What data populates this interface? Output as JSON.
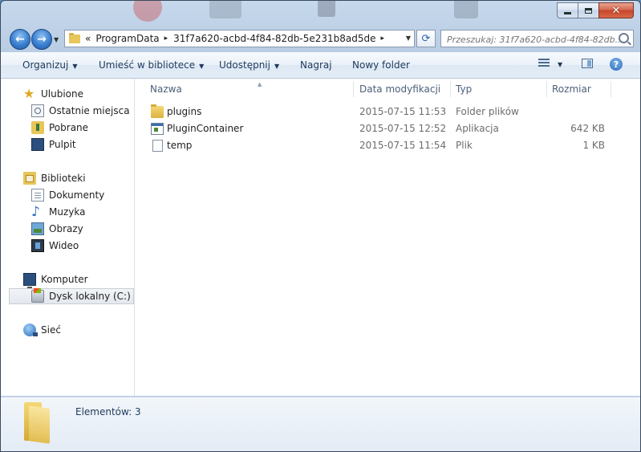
{
  "window": {
    "controls": {
      "minimize_glyph": "",
      "maximize_glyph": "",
      "close_glyph": "✕"
    },
    "colors": {
      "accent": "#3a7fd0",
      "frame": "#b9cde3",
      "close": "#c7462a"
    }
  },
  "address_bar": {
    "overflow": "«",
    "crumbs": [
      "ProgramData",
      "31f7a620-acbd-4f84-82db-5e231b8ad5de"
    ],
    "separator": "▸"
  },
  "search": {
    "placeholder": "Przeszukaj: 31f7a620-acbd-4f84-82db..."
  },
  "toolbar": {
    "organize": "Organizuj",
    "include_in_library": "Umieść w bibliotece",
    "share": "Udostępnij",
    "burn": "Nagraj",
    "new_folder": "Nowy folder",
    "help": "?"
  },
  "sidebar": {
    "favorites": {
      "label": "Ulubione",
      "items": [
        {
          "label": "Ostatnie miejsca",
          "icon": "recent-places-icon"
        },
        {
          "label": "Pobrane",
          "icon": "downloads-icon"
        },
        {
          "label": "Pulpit",
          "icon": "desktop-icon"
        }
      ]
    },
    "libraries": {
      "label": "Biblioteki",
      "items": [
        {
          "label": "Dokumenty",
          "icon": "documents-icon"
        },
        {
          "label": "Muzyka",
          "icon": "music-icon"
        },
        {
          "label": "Obrazy",
          "icon": "pictures-icon"
        },
        {
          "label": "Wideo",
          "icon": "video-icon"
        }
      ]
    },
    "computer": {
      "label": "Komputer",
      "items": [
        {
          "label": "Dysk lokalny (C:)",
          "icon": "local-disk-icon",
          "selected": true
        }
      ]
    },
    "network": {
      "label": "Sieć"
    }
  },
  "columns": {
    "name": "Nazwa",
    "modified": "Data modyfikacji",
    "type": "Typ",
    "size": "Rozmiar"
  },
  "files": [
    {
      "name": "plugins",
      "modified": "2015-07-15 11:53",
      "type": "Folder plików",
      "size": "",
      "icon": "folder-icon"
    },
    {
      "name": "PluginContainer",
      "modified": "2015-07-15 12:52",
      "type": "Aplikacja",
      "size": "642 KB",
      "icon": "application-icon"
    },
    {
      "name": "temp",
      "modified": "2015-07-15 11:54",
      "type": "Plik",
      "size": "1 KB",
      "icon": "file-icon"
    }
  ],
  "details": {
    "count": "Elementów: 3"
  }
}
